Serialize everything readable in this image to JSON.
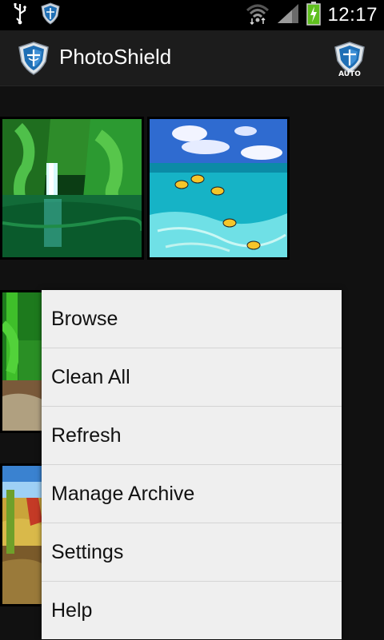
{
  "status_bar": {
    "time": "12:17",
    "icons": [
      "usb-icon",
      "shield-notification-icon",
      "wifi-icon",
      "signal-icon",
      "battery-charging-icon"
    ]
  },
  "action_bar": {
    "title": "PhotoShield",
    "logo_icon": "shield-icon",
    "auto_button_label": "AUTO"
  },
  "gallery": {
    "thumbnails": [
      "waterfall-photo",
      "ocean-fish-photo",
      "forest-photo",
      "autumn-landscape-photo"
    ]
  },
  "menu": {
    "items": [
      "Browse",
      "Clean All",
      "Refresh",
      "Manage Archive",
      "Settings",
      "Help"
    ]
  },
  "colors": {
    "background": "#111111",
    "action_bar": "#1c1c1c",
    "menu_background": "#efefef",
    "shield_blue": "#1f6fb5"
  }
}
